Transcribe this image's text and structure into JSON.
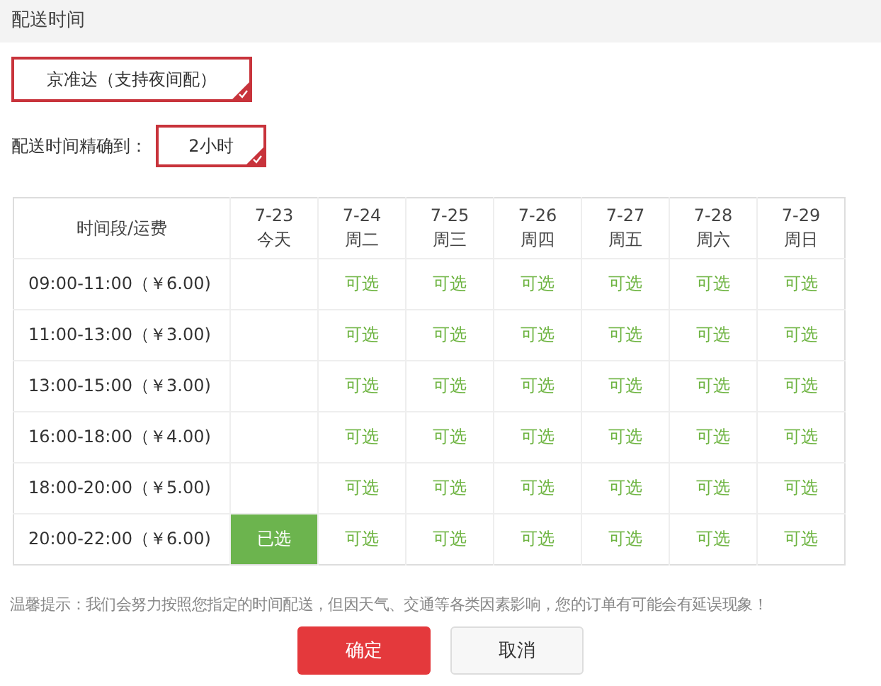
{
  "header": {
    "title": "配送时间"
  },
  "carrier_option": {
    "label": "京准达（支持夜间配）",
    "selected": true
  },
  "precision": {
    "label": "配送时间精确到：",
    "option": {
      "label": "2小时",
      "selected": true
    }
  },
  "table": {
    "corner": "时间段/运费",
    "columns": [
      {
        "date": "7-23",
        "day": "今天"
      },
      {
        "date": "7-24",
        "day": "周二"
      },
      {
        "date": "7-25",
        "day": "周三"
      },
      {
        "date": "7-26",
        "day": "周四"
      },
      {
        "date": "7-27",
        "day": "周五"
      },
      {
        "date": "7-28",
        "day": "周六"
      },
      {
        "date": "7-29",
        "day": "周日"
      }
    ],
    "rows": [
      {
        "slot": "09:00-11:00（￥6.00)",
        "cells": [
          {
            "kind": "blank"
          },
          {
            "kind": "slot",
            "text": "可选",
            "selected": false
          },
          {
            "kind": "slot",
            "text": "可选",
            "selected": false
          },
          {
            "kind": "slot",
            "text": "可选",
            "selected": false
          },
          {
            "kind": "slot",
            "text": "可选",
            "selected": false
          },
          {
            "kind": "slot",
            "text": "可选",
            "selected": false
          },
          {
            "kind": "slot",
            "text": "可选",
            "selected": false
          }
        ]
      },
      {
        "slot": "11:00-13:00（￥3.00)",
        "cells": [
          {
            "kind": "blank"
          },
          {
            "kind": "slot",
            "text": "可选",
            "selected": false
          },
          {
            "kind": "slot",
            "text": "可选",
            "selected": false
          },
          {
            "kind": "slot",
            "text": "可选",
            "selected": false
          },
          {
            "kind": "slot",
            "text": "可选",
            "selected": false
          },
          {
            "kind": "slot",
            "text": "可选",
            "selected": false
          },
          {
            "kind": "slot",
            "text": "可选",
            "selected": false
          }
        ]
      },
      {
        "slot": "13:00-15:00（￥3.00)",
        "cells": [
          {
            "kind": "blank"
          },
          {
            "kind": "slot",
            "text": "可选",
            "selected": false
          },
          {
            "kind": "slot",
            "text": "可选",
            "selected": false
          },
          {
            "kind": "slot",
            "text": "可选",
            "selected": false
          },
          {
            "kind": "slot",
            "text": "可选",
            "selected": false
          },
          {
            "kind": "slot",
            "text": "可选",
            "selected": false
          },
          {
            "kind": "slot",
            "text": "可选",
            "selected": false
          }
        ]
      },
      {
        "slot": "16:00-18:00（￥4.00)",
        "cells": [
          {
            "kind": "blank"
          },
          {
            "kind": "slot",
            "text": "可选",
            "selected": false
          },
          {
            "kind": "slot",
            "text": "可选",
            "selected": false
          },
          {
            "kind": "slot",
            "text": "可选",
            "selected": false
          },
          {
            "kind": "slot",
            "text": "可选",
            "selected": false
          },
          {
            "kind": "slot",
            "text": "可选",
            "selected": false
          },
          {
            "kind": "slot",
            "text": "可选",
            "selected": false
          }
        ]
      },
      {
        "slot": "18:00-20:00（￥5.00)",
        "cells": [
          {
            "kind": "blank"
          },
          {
            "kind": "slot",
            "text": "可选",
            "selected": false
          },
          {
            "kind": "slot",
            "text": "可选",
            "selected": false
          },
          {
            "kind": "slot",
            "text": "可选",
            "selected": false
          },
          {
            "kind": "slot",
            "text": "可选",
            "selected": false
          },
          {
            "kind": "slot",
            "text": "可选",
            "selected": false
          },
          {
            "kind": "slot",
            "text": "可选",
            "selected": false
          }
        ]
      },
      {
        "slot": "20:00-22:00（￥6.00)",
        "cells": [
          {
            "kind": "slot",
            "text": "已选",
            "selected": true
          },
          {
            "kind": "slot",
            "text": "可选",
            "selected": false
          },
          {
            "kind": "slot",
            "text": "可选",
            "selected": false
          },
          {
            "kind": "slot",
            "text": "可选",
            "selected": false
          },
          {
            "kind": "slot",
            "text": "可选",
            "selected": false
          },
          {
            "kind": "slot",
            "text": "可选",
            "selected": false
          },
          {
            "kind": "slot",
            "text": "可选",
            "selected": false
          }
        ]
      }
    ]
  },
  "tip": "温馨提示：我们会努力按照您指定的时间配送，但因天气、交通等各类因素影响，您的订单有可能会有延误现象！",
  "buttons": [
    {
      "kind": "primary",
      "label": "确定"
    },
    {
      "kind": "secondary",
      "label": "取消"
    }
  ]
}
